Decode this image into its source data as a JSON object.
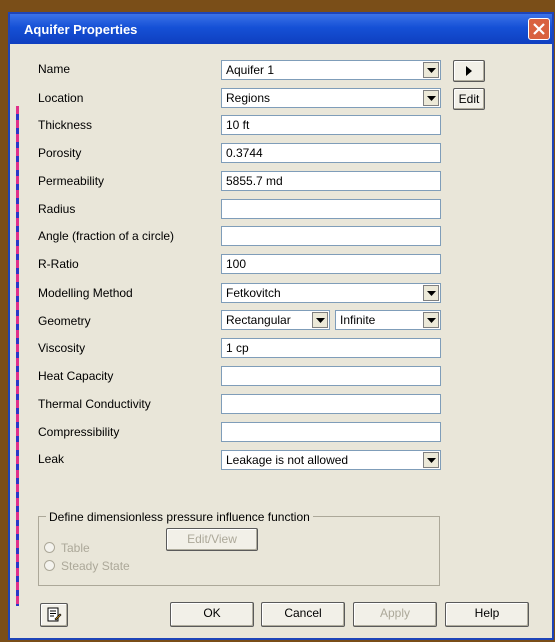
{
  "window": {
    "title": "Aquifer Properties"
  },
  "fields": {
    "name": {
      "label": "Name",
      "value": "Aquifer 1"
    },
    "location": {
      "label": "Location",
      "value": "Regions"
    },
    "thickness": {
      "label": "Thickness",
      "value": "10 ft"
    },
    "porosity": {
      "label": "Porosity",
      "value": "0.3744"
    },
    "permeability": {
      "label": "Permeability",
      "value": "5855.7 md"
    },
    "radius": {
      "label": "Radius",
      "value": ""
    },
    "angle": {
      "label": "Angle (fraction of a circle)",
      "value": ""
    },
    "r_ratio": {
      "label": "R-Ratio",
      "value": "100"
    },
    "modelling_method": {
      "label": "Modelling Method",
      "value": "Fetkovitch"
    },
    "geometry": {
      "label": "Geometry",
      "shape": "Rectangular",
      "extent": "Infinite"
    },
    "viscosity": {
      "label": "Viscosity",
      "value": "1 cp"
    },
    "heat_capacity": {
      "label": "Heat Capacity",
      "value": ""
    },
    "thermal_conductivity": {
      "label": "Thermal Conductivity",
      "value": ""
    },
    "compressibility": {
      "label": "Compressibility",
      "value": ""
    },
    "leak": {
      "label": "Leak",
      "value": "Leakage is not allowed"
    }
  },
  "side_buttons": {
    "edit_label": "Edit"
  },
  "influence_group": {
    "title": "Define dimensionless pressure influence function",
    "edit_view_label": "Edit/View",
    "options": [
      "Table",
      "Steady State"
    ]
  },
  "footer": {
    "ok": "OK",
    "cancel": "Cancel",
    "apply": "Apply",
    "help": "Help"
  },
  "icons": {
    "close": "close-icon",
    "arrow": "play-arrow-icon",
    "dropdown": "chevron-down-icon",
    "notes": "notepad-icon"
  }
}
